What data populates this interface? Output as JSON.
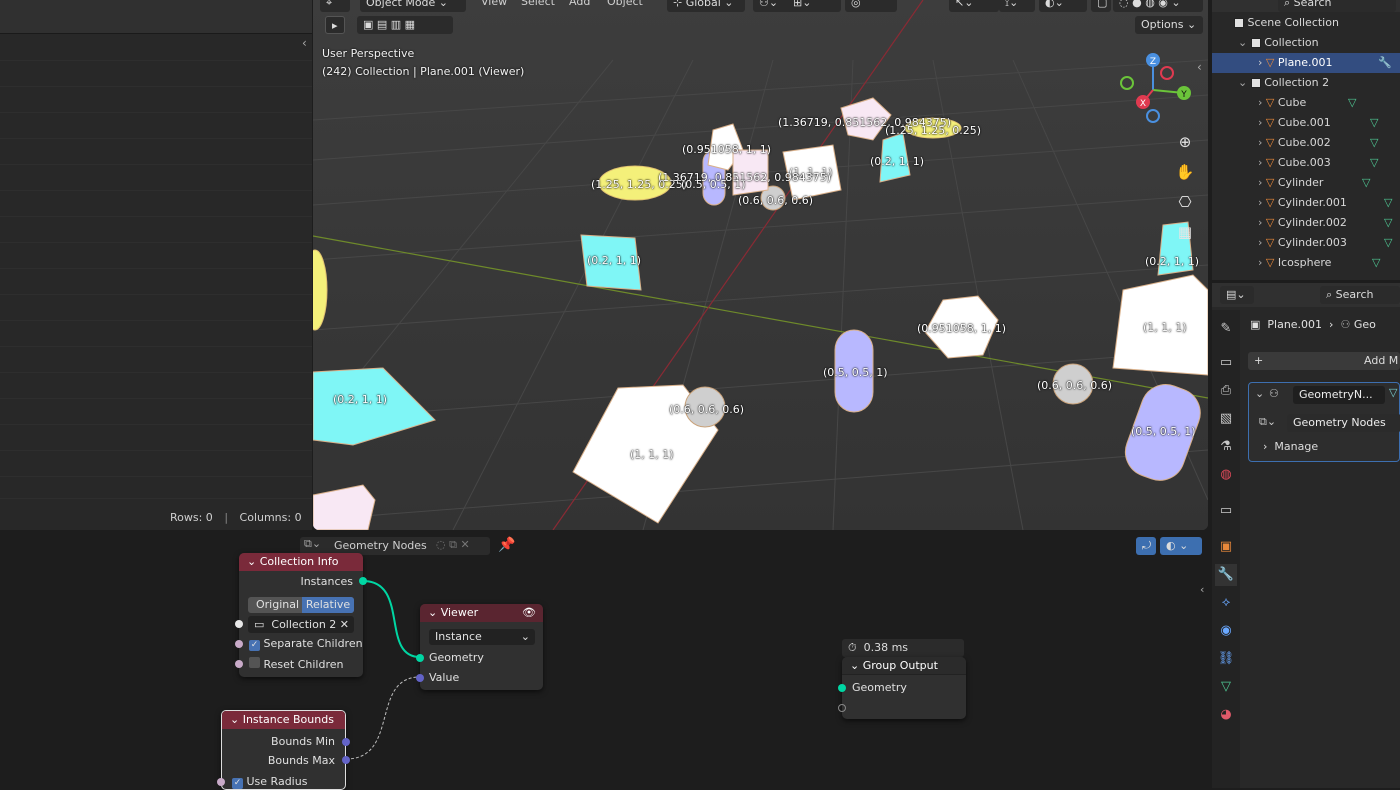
{
  "viewport_header": {
    "mode": "Object Mode",
    "menus": [
      "View",
      "Select",
      "Add",
      "Object"
    ],
    "transform": "Global",
    "options": "Options"
  },
  "viewport": {
    "perspective": "User Perspective",
    "context": "(242) Collection | Plane.001 (Viewer)",
    "gizmo": {
      "z": "Z",
      "y": "Y",
      "x": "X"
    },
    "labels": [
      "(1.36719, 0.851562, 0.984375)",
      "(1.25, 1.25, 0.25)",
      "(0.951058, 1, 1)",
      "(1, 1, 1)",
      "(0.2, 1, 1)",
      "(1.25, 1.25, 0.25)",
      "(1.36719, 0.851562, 0.984375)",
      "(0.5, 0.5, 1)",
      "(0.6, 0.6, 0.6)",
      "(0.2, 1, 1)",
      "(0.2, 1, 1)",
      "(0.951058, 1, 1)",
      "(1, 1, 1)",
      "(0.5, 0.5, 1)",
      "(0.6, 0.6, 0.6)",
      "(0.2, 1, 1)",
      "(0.6, 0.6, 0.6)",
      "(1, 1, 1)",
      "(0.5, 0.5, 1)"
    ]
  },
  "spreadsheet": {
    "rows": "Rows: 0",
    "columns": "Columns: 0"
  },
  "outliner": {
    "search": "Search",
    "scene_collection": "Scene Collection",
    "items": [
      {
        "name": "Collection",
        "level": 1,
        "type": "collection"
      },
      {
        "name": "Plane.001",
        "level": 2,
        "type": "mesh",
        "selected": true
      },
      {
        "name": "Collection 2",
        "level": 1,
        "type": "collection"
      },
      {
        "name": "Cube",
        "level": 2,
        "type": "mesh"
      },
      {
        "name": "Cube.001",
        "level": 2,
        "type": "mesh"
      },
      {
        "name": "Cube.002",
        "level": 2,
        "type": "mesh"
      },
      {
        "name": "Cube.003",
        "level": 2,
        "type": "mesh"
      },
      {
        "name": "Cylinder",
        "level": 2,
        "type": "mesh"
      },
      {
        "name": "Cylinder.001",
        "level": 2,
        "type": "mesh"
      },
      {
        "name": "Cylinder.002",
        "level": 2,
        "type": "mesh"
      },
      {
        "name": "Cylinder.003",
        "level": 2,
        "type": "mesh"
      },
      {
        "name": "Icosphere",
        "level": 2,
        "type": "mesh"
      }
    ]
  },
  "properties": {
    "search": "Search",
    "object": "Plane.001",
    "breadcrumb_next": "Geo",
    "add_modifier": "Add M",
    "modifier_name": "GeometryN...",
    "node_group": "Geometry Nodes",
    "manage": "Manage"
  },
  "node_editor": {
    "title": "Geometry Nodes",
    "timing": "0.38 ms",
    "nodes": {
      "collection_info": {
        "title": "Collection Info",
        "instances": "Instances",
        "original": "Original",
        "relative": "Relative",
        "collection": "Collection 2",
        "separate_children": "Separate Children",
        "reset_children": "Reset Children"
      },
      "viewer": {
        "title": "Viewer",
        "domain": "Instance",
        "geometry": "Geometry",
        "value": "Value"
      },
      "group_output": {
        "title": "Group Output",
        "geometry": "Geometry"
      },
      "instance_bounds": {
        "title": "Instance Bounds",
        "bounds_min": "Bounds Min",
        "bounds_max": "Bounds Max",
        "use_radius": "Use Radius"
      }
    }
  },
  "colors": {
    "selection": "#334d80",
    "node_header": "#7a2a3a",
    "socket_geometry": "#00d6a3",
    "socket_vector": "#6363c7"
  }
}
